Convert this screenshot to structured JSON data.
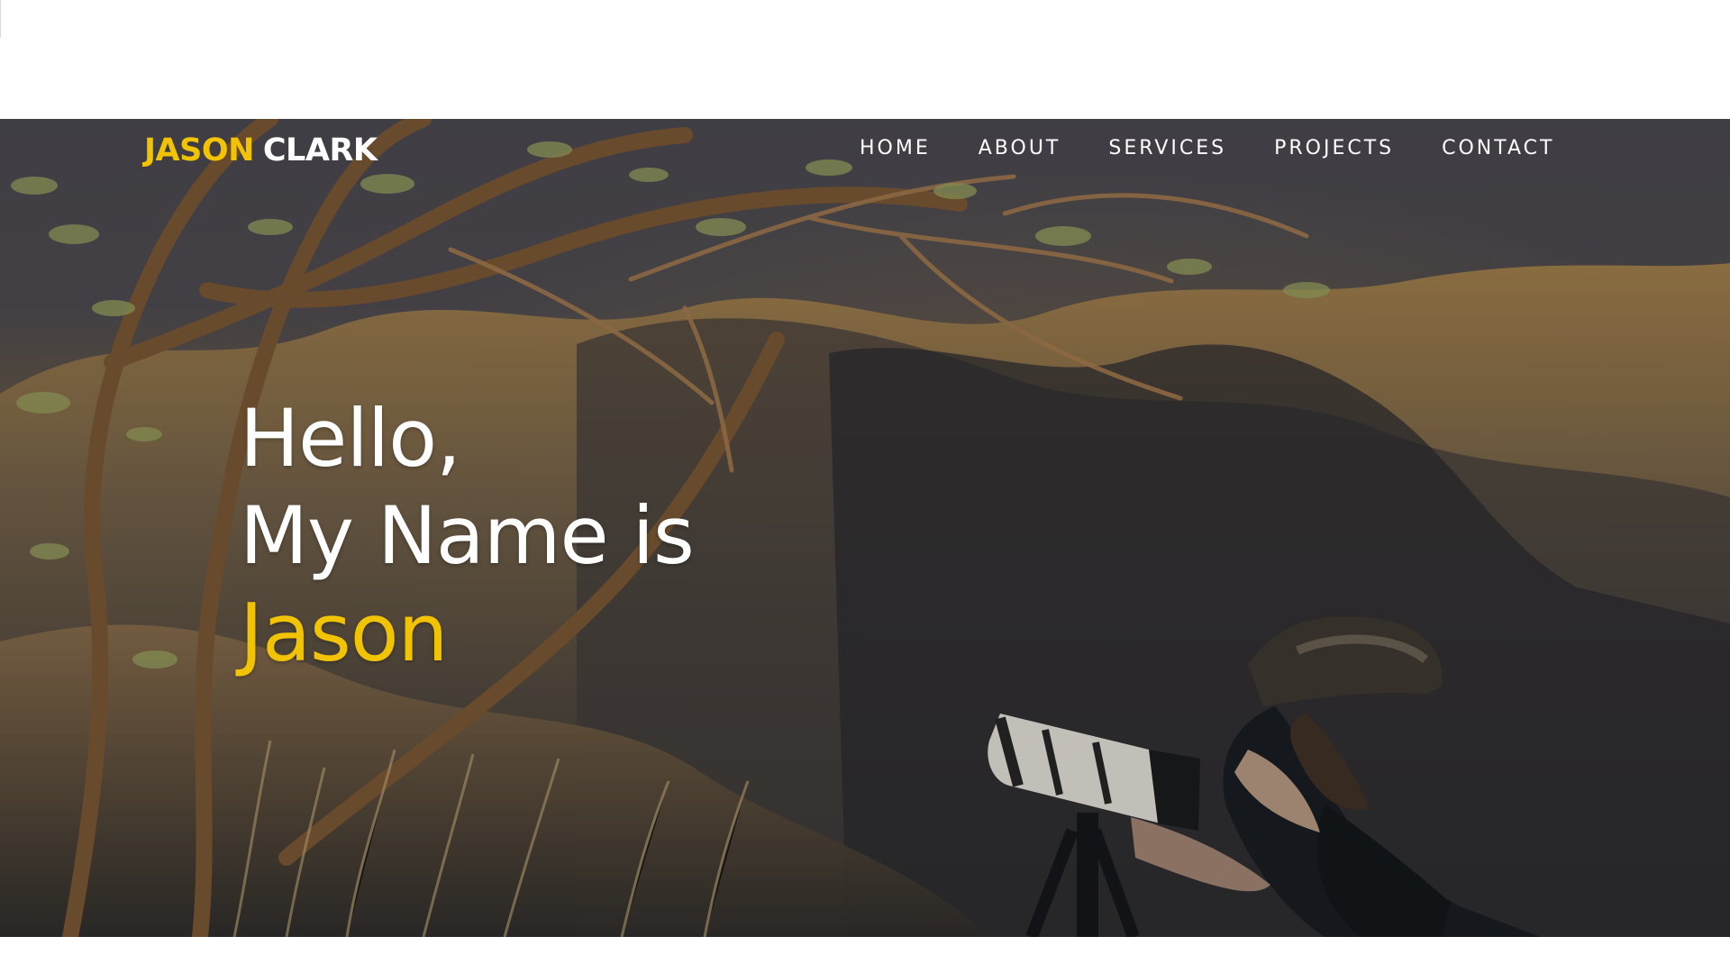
{
  "brand": {
    "first_name": "JASON",
    "last_name": "CLARK",
    "accent_color": "#f2c300",
    "text_color": "#ffffff"
  },
  "navigation": {
    "items": [
      {
        "label": "HOME"
      },
      {
        "label": "ABOUT"
      },
      {
        "label": "SERVICES"
      },
      {
        "label": "PROJECTS"
      },
      {
        "label": "CONTACT"
      }
    ]
  },
  "hero": {
    "greeting": "Hello,",
    "intro": "My Name is",
    "name": "Jason"
  }
}
